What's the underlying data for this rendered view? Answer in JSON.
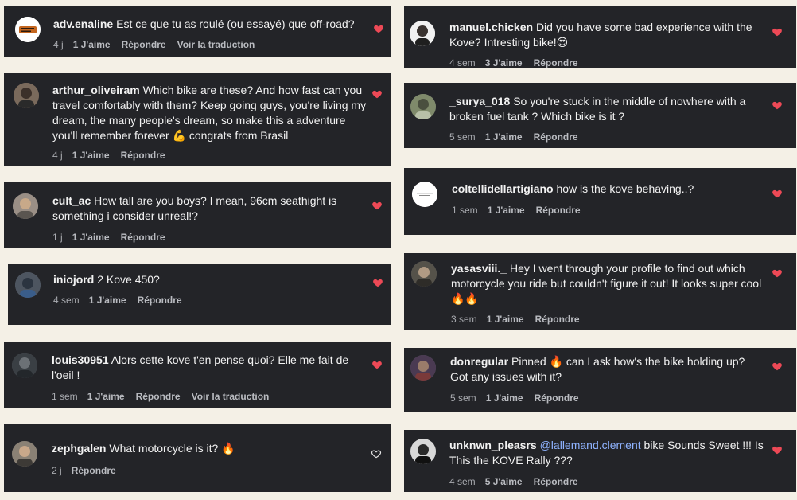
{
  "colors": {
    "card_bg": "#232428",
    "page_bg": "#f4f0e6",
    "heart": "#ed4956",
    "meta": "#a9abb0",
    "mention": "#8fb3ff"
  },
  "comments": [
    {
      "user": "adv.enaline",
      "text": "Est ce que tu as roulé (ou essayé) que off-road?",
      "time": "4 j",
      "likes": "1 J'aime",
      "reply": "Répondre",
      "translate": "Voir la traduction",
      "liked": true
    },
    {
      "user": "arthur_oliveiram",
      "text": "Which bike are these? And how fast can you travel comfortably with them? Keep going guys, you're living my dream, the many people's dream, so make this a adventure you'll remember forever 💪 congrats from Brasil",
      "time": "4 j",
      "likes": "1 J'aime",
      "reply": "Répondre",
      "liked": true
    },
    {
      "user": "cult_ac",
      "text": "How tall are you boys? I mean, 96cm seathight is something i consider unreal!?",
      "time": "1 j",
      "likes": "1 J'aime",
      "reply": "Répondre",
      "liked": true
    },
    {
      "user": "iniojord",
      "text": "2 Kove 450?",
      "time": "4 sem",
      "likes": "1 J'aime",
      "reply": "Répondre",
      "liked": true
    },
    {
      "user": "louis30951",
      "text": "Alors cette kove t'en pense quoi? Elle me fait de l'oeil !",
      "time": "1 sem",
      "likes": "1 J'aime",
      "reply": "Répondre",
      "translate": "Voir la traduction",
      "liked": true
    },
    {
      "user": "zephgalen",
      "text": "What motorcycle is it? 🔥",
      "time": "2 j",
      "reply": "Répondre",
      "liked": false
    },
    {
      "user": "manuel.chicken",
      "text": "Did you have some bad experience with the Kove? Intresting bike!😍",
      "time": "4 sem",
      "likes": "3 J'aime",
      "reply": "Répondre",
      "liked": true
    },
    {
      "user": "_surya_018",
      "text": "So you're stuck in the middle of nowhere with a broken fuel tank ? Which bike is it ?",
      "time": "5 sem",
      "likes": "1 J'aime",
      "reply": "Répondre",
      "liked": true
    },
    {
      "user": "coltellidellartigiano",
      "text": "how is the kove behaving..?",
      "time": "1 sem",
      "likes": "1 J'aime",
      "reply": "Répondre",
      "liked": true
    },
    {
      "user": "yasasviii._",
      "text": "Hey I went through your profile to find out which motorcycle you ride but couldn't figure it out! It looks super cool🔥🔥",
      "time": "3 sem",
      "likes": "1 J'aime",
      "reply": "Répondre",
      "liked": true
    },
    {
      "user": "donregular",
      "text": "Pinned 🔥 can I ask how's the bike holding up? Got any issues with it?",
      "time": "5 sem",
      "likes": "1 J'aime",
      "reply": "Répondre",
      "liked": true
    },
    {
      "user": "unknwn_pleasrs",
      "mention": "@lallemand.clement",
      "text": "bike Sounds Sweet !!! Is This the KOVE Rally ???",
      "time": "4 sem",
      "likes": "5 J'aime",
      "reply": "Répondre",
      "liked": true
    }
  ]
}
